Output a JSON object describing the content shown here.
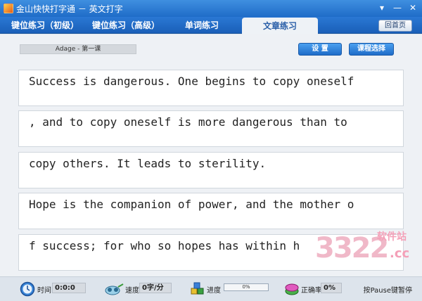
{
  "window": {
    "title": "金山快快打字通 － 英文打字",
    "buttons": [
      "▾",
      "—",
      "✕"
    ]
  },
  "tabs": [
    {
      "label": "键位练习（初级）",
      "active": false
    },
    {
      "label": "键位练习（高级）",
      "active": false
    },
    {
      "label": "单词练习",
      "active": false
    },
    {
      "label": "文章练习",
      "active": true
    }
  ],
  "home_button": "回首页",
  "lesson_label": "Adage - 第一课",
  "settings_button": "设  置",
  "course_button": "课程选择",
  "lines": [
    "Success is dangerous. One begins to copy oneself",
    ", and to copy oneself is more dangerous than to",
    "copy others. It leads to sterility.",
    "Hope is the companion of power, and the mother o",
    "f success; for who so hopes has within h"
  ],
  "status": {
    "time_label": "时间",
    "time_value": "0:0:0",
    "speed_label": "速度",
    "speed_value": "0字/分",
    "progress_label": "进度",
    "progress_value": "0%",
    "accuracy_label": "正确率",
    "accuracy_value": "0%",
    "pause_hint": "按Pause键暂停"
  },
  "watermark": {
    "number": "3322",
    "top": "软件站",
    "suffix": ".cc"
  },
  "colors": {
    "title_bar": "#1f6cc8",
    "tab_active_text": "#2a5fa8",
    "button": "#1f6cc8"
  }
}
